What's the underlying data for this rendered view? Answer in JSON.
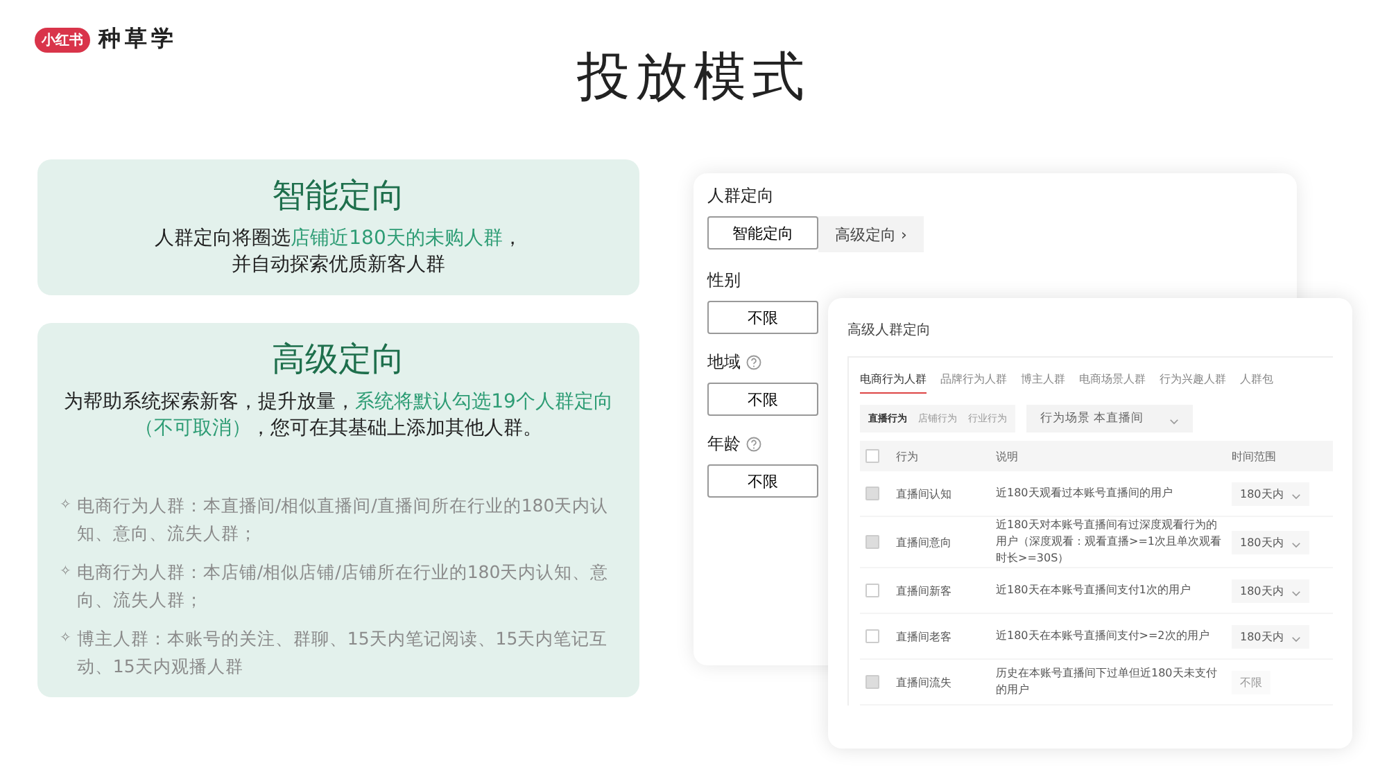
{
  "brand": {
    "logo": "小红书",
    "name": "种草学"
  },
  "title": "投放模式",
  "cards": [
    {
      "title": "智能定向",
      "body": [
        {
          "text": "人群定向将圈选",
          "highlight": false
        },
        {
          "text": "店铺近180天的未购人群",
          "highlight": true
        },
        {
          "text": "，",
          "highlight": false
        }
      ],
      "body_line2": [
        {
          "text": "并自动探索优质新客人群",
          "highlight": false
        }
      ]
    },
    {
      "title": "高级定向",
      "body": [
        {
          "text": "为帮助系统探索新客，提升放量，",
          "highlight": false
        },
        {
          "text": "系统将默认勾选19个人群定向（不可取消）",
          "highlight": true
        },
        {
          "text": "，您可在其基础上添加其他人群。",
          "highlight": false
        }
      ],
      "bullets": [
        {
          "mark": "✧",
          "text": "电商行为人群：本直播间/相似直播间/直播间所在行业的180天内认知、意向、流失人群；"
        },
        {
          "mark": "✧",
          "text": "电商行为人群：本店铺/相似店铺/店铺所在行业的180天内认知、意向、流失人群；"
        },
        {
          "mark": "✧",
          "text": "博主人群：本账号的关注、群聊、15天内笔记阅读、15天内笔记互动、15天内观播人群"
        }
      ]
    }
  ],
  "settings": {
    "sections": [
      {
        "label": "人群定向",
        "help": false,
        "options": [
          {
            "kind": "option",
            "label": "智能定向"
          },
          {
            "kind": "link",
            "label": "高级定向",
            "chevron": "›"
          }
        ]
      },
      {
        "label": "性别",
        "help": false,
        "options": [
          {
            "kind": "option",
            "label": "不限"
          }
        ]
      },
      {
        "label": "地域",
        "help": true,
        "options": [
          {
            "kind": "option",
            "label": "不限"
          }
        ]
      },
      {
        "label": "年龄",
        "help": true,
        "options": [
          {
            "kind": "option",
            "label": "不限"
          }
        ]
      }
    ]
  },
  "dialog": {
    "title": "高级人群定向",
    "tabs": [
      {
        "label": "电商行为人群",
        "selected": true
      },
      {
        "label": "品牌行为人群",
        "selected": false
      },
      {
        "label": "博主人群",
        "selected": false
      },
      {
        "label": "电商场景人群",
        "selected": false
      },
      {
        "label": "行为兴趣人群",
        "selected": false
      },
      {
        "label": "人群包",
        "selected": false
      }
    ],
    "subtabs": [
      {
        "label": "直播行为",
        "selected": true
      },
      {
        "label": "店铺行为",
        "selected": false
      },
      {
        "label": "行业行为",
        "selected": false
      }
    ],
    "filter": {
      "label": "行为场景",
      "value": "本直播间"
    },
    "columns": [
      "行为",
      "说明",
      "时间范围"
    ],
    "header_checked": false,
    "rows": [
      {
        "checked": true,
        "behavior": "直播间认知",
        "desc": "近180天观看过本账号直播间的用户",
        "range": "180天内",
        "disabled": false
      },
      {
        "checked": true,
        "behavior": "直播间意向",
        "desc": "近180天对本账号直播间有过深度观看行为的用户（深度观看：观看直播>=1次且单次观看时长>=30S）",
        "range": "180天内",
        "disabled": false
      },
      {
        "checked": false,
        "behavior": "直播间新客",
        "desc": "近180天在本账号直播间支付1次的用户",
        "range": "180天内",
        "disabled": false
      },
      {
        "checked": false,
        "behavior": "直播间老客",
        "desc": "近180天在本账号直播间支付>=2次的用户",
        "range": "180天内",
        "disabled": false
      },
      {
        "checked": true,
        "behavior": "直播间流失",
        "desc": "历史在本账号直播间下过单但近180天未支付的用户",
        "range": "不限",
        "disabled": true
      }
    ]
  }
}
